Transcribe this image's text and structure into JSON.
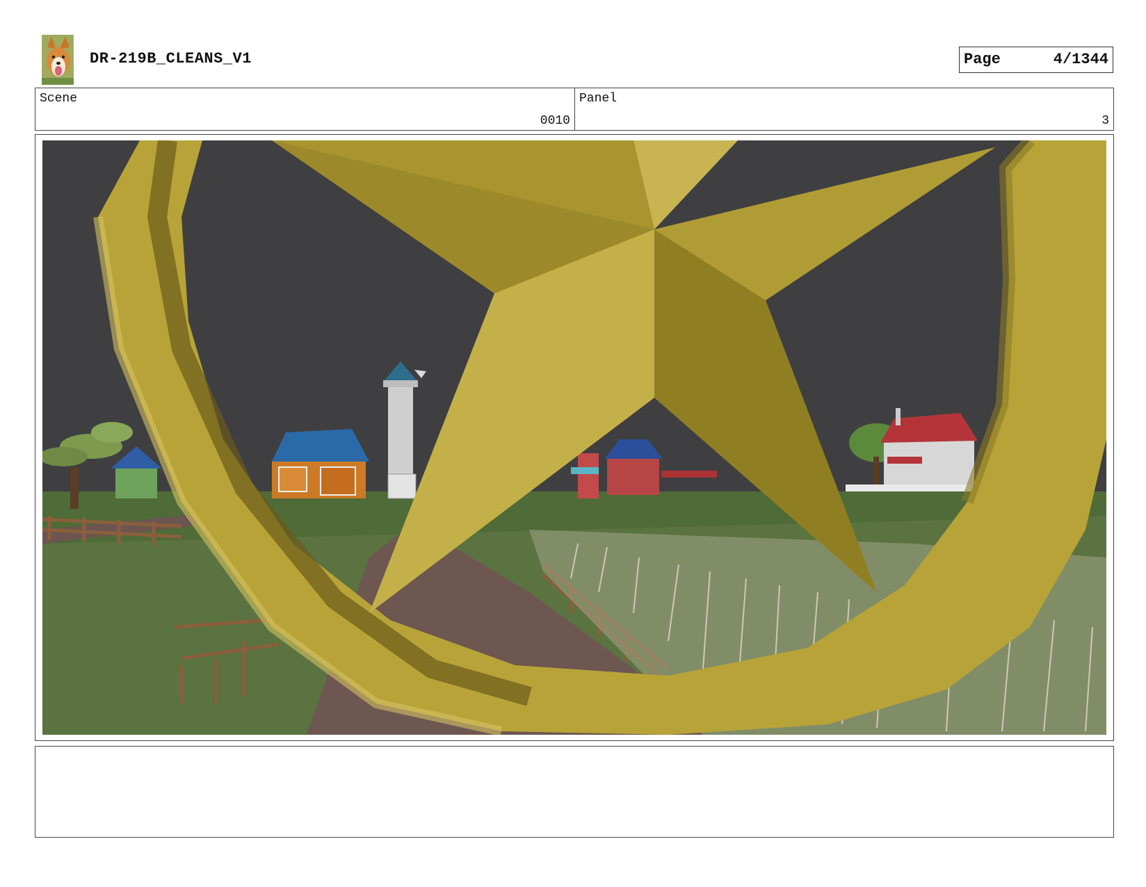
{
  "header": {
    "title": "DR-219B_CLEANS_V1",
    "page_label": "Page",
    "page_number": "4/1344"
  },
  "info": {
    "scene_label": "Scene",
    "scene_value": "0010",
    "panel_label": "Panel",
    "panel_value": "3"
  },
  "notes": {
    "text": ""
  },
  "colors": {
    "sky": "#3f3f41",
    "star": "#b8a338",
    "grass": "#5a7340",
    "path": "#6e5651"
  }
}
